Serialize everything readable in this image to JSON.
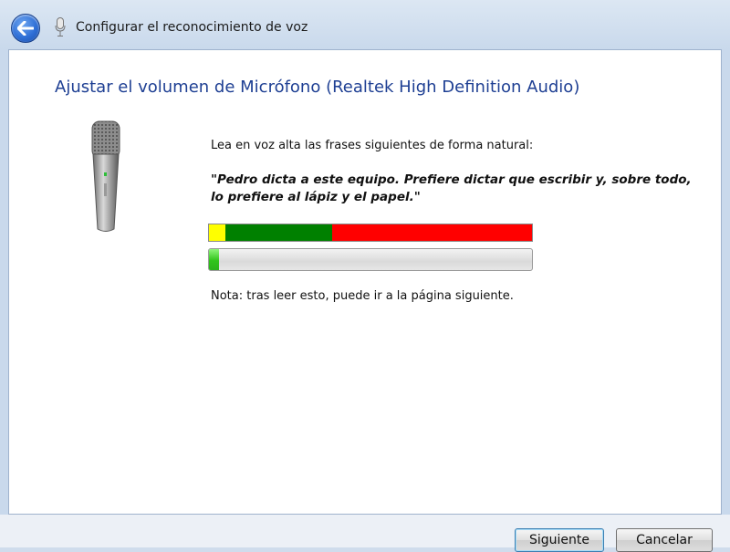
{
  "window": {
    "title": "Configurar el reconocimiento de voz",
    "back_icon": "back-arrow-icon",
    "app_icon": "microphone-icon"
  },
  "page": {
    "heading": "Ajustar el volumen de Micrófono (Realtek High Definition Audio)",
    "instruction": "Lea en voz alta las frases siguientes de forma natural:",
    "phrase": "\"Pedro dicta a este equipo. Prefiere dictar que escribir y, sobre todo, lo prefiere al lápiz y el papel.\"",
    "note": "Nota: tras leer esto, puede ir a la página siguiente.",
    "illustration_icon": "microphone-icon"
  },
  "level_zones": {
    "colors": [
      "#ffff00",
      "#008000",
      "#ff0000"
    ],
    "fractions": [
      0.05,
      0.33,
      0.62
    ]
  },
  "volume_meter": {
    "level": 0.03,
    "color": "#31c41b"
  },
  "buttons": {
    "next": "Siguiente",
    "cancel": "Cancelar"
  }
}
